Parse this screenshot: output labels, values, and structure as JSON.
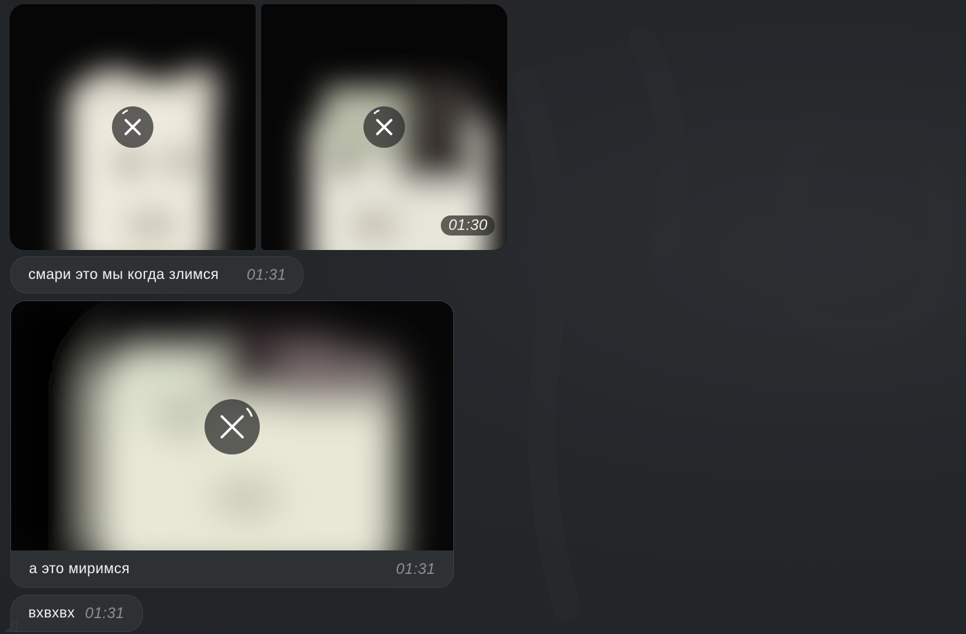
{
  "chat": {
    "album": {
      "photos": [
        {
          "icon": "close-icon",
          "state": "loading"
        },
        {
          "icon": "close-icon",
          "state": "loading"
        }
      ],
      "time": "01:30"
    },
    "messages": [
      {
        "text": "смари это мы когда злимся",
        "time": "01:31"
      },
      {
        "text": "а это миримся",
        "time": "01:31",
        "has_photo": true,
        "icon": "close-icon"
      },
      {
        "text": "вхвхвх",
        "time": "01:31"
      }
    ]
  },
  "colors": {
    "background": "#24272a",
    "bubble": "#2e3134",
    "bubble_border": "#3a3e41",
    "time_text": "#8a9095",
    "message_text": "#f2f2f2"
  }
}
